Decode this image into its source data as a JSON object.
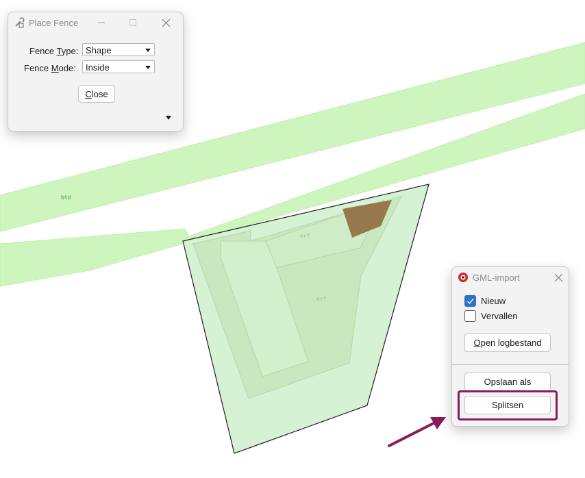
{
  "map": {
    "labels": {
      "btd": "btd",
      "erf_top": "erf",
      "erf_mid": "erf"
    },
    "colors": {
      "road_fill": "#cdf5bd",
      "parcel_fill": "#d6f2d4",
      "building_fill": "#c9e8c0",
      "selected_fill": "#8d6437",
      "outline": "#1f1f1f",
      "arrow": "#8a1a5a"
    }
  },
  "place_fence": {
    "title": "Place Fence",
    "icon": "fence-tool-icon",
    "fence_type_label_pre": "Fence ",
    "fence_type_label_key": "T",
    "fence_type_label_post": "ype:",
    "fence_type_value": "Shape",
    "fence_mode_label_pre": "Fence ",
    "fence_mode_label_key": "M",
    "fence_mode_label_post": "ode:",
    "fence_mode_value": "Inside",
    "close_key": "C",
    "close_rest": "lose"
  },
  "gml_import": {
    "title": "GML-import",
    "icon": "gml-app-icon",
    "check_nieuw_label": "Nieuw",
    "check_nieuw_checked": true,
    "check_vervallen_label": "Vervallen",
    "check_vervallen_checked": false,
    "open_log_key": "O",
    "open_log_rest": "pen logbestand",
    "save_as_label": "Opslaan als",
    "split_label": "Splitsen",
    "highlight_color": "#8a1a5a"
  }
}
